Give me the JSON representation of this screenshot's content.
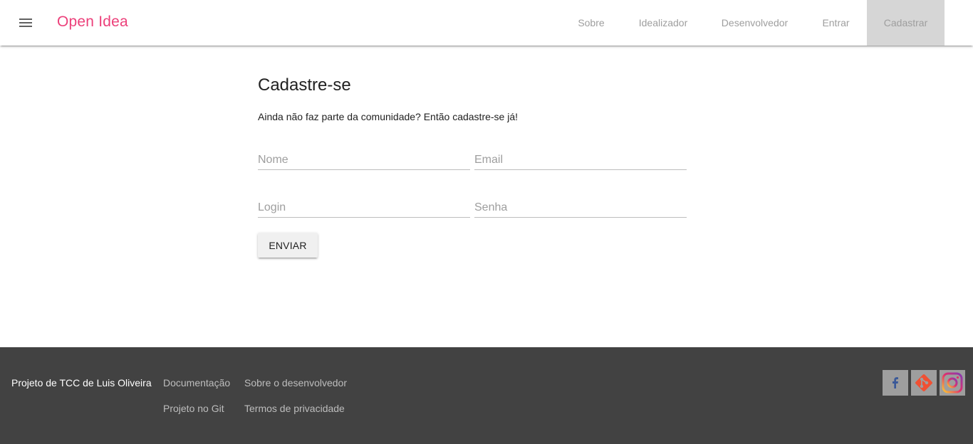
{
  "header": {
    "brand": "Open Idea",
    "nav": [
      {
        "label": "Sobre"
      },
      {
        "label": "Idealizador"
      },
      {
        "label": "Desenvolvedor"
      },
      {
        "label": "Entrar"
      },
      {
        "label": "Cadastrar",
        "active": true
      }
    ]
  },
  "signup": {
    "title": "Cadastre-se",
    "subtitle": "Ainda não faz parte da comunidade? Então cadastre-se já!",
    "fields": {
      "name": {
        "placeholder": "Nome",
        "value": ""
      },
      "email": {
        "placeholder": "Email",
        "value": ""
      },
      "login": {
        "placeholder": "Login",
        "value": ""
      },
      "password": {
        "placeholder": "Senha",
        "value": ""
      }
    },
    "submit_label": "ENVIAR"
  },
  "footer": {
    "credit": "Projeto de TCC de Luis Oliveira",
    "links": [
      {
        "label": "Documentação"
      },
      {
        "label": "Sobre o desenvolvedor"
      },
      {
        "label": "Projeto no Git"
      },
      {
        "label": "Termos de privacidade"
      }
    ],
    "social": [
      "facebook-icon",
      "git-icon",
      "instagram-icon"
    ]
  },
  "colors": {
    "brand": "#ec407a",
    "footer_bg": "#424242",
    "active_tab_bg": "#d6d6d6"
  }
}
